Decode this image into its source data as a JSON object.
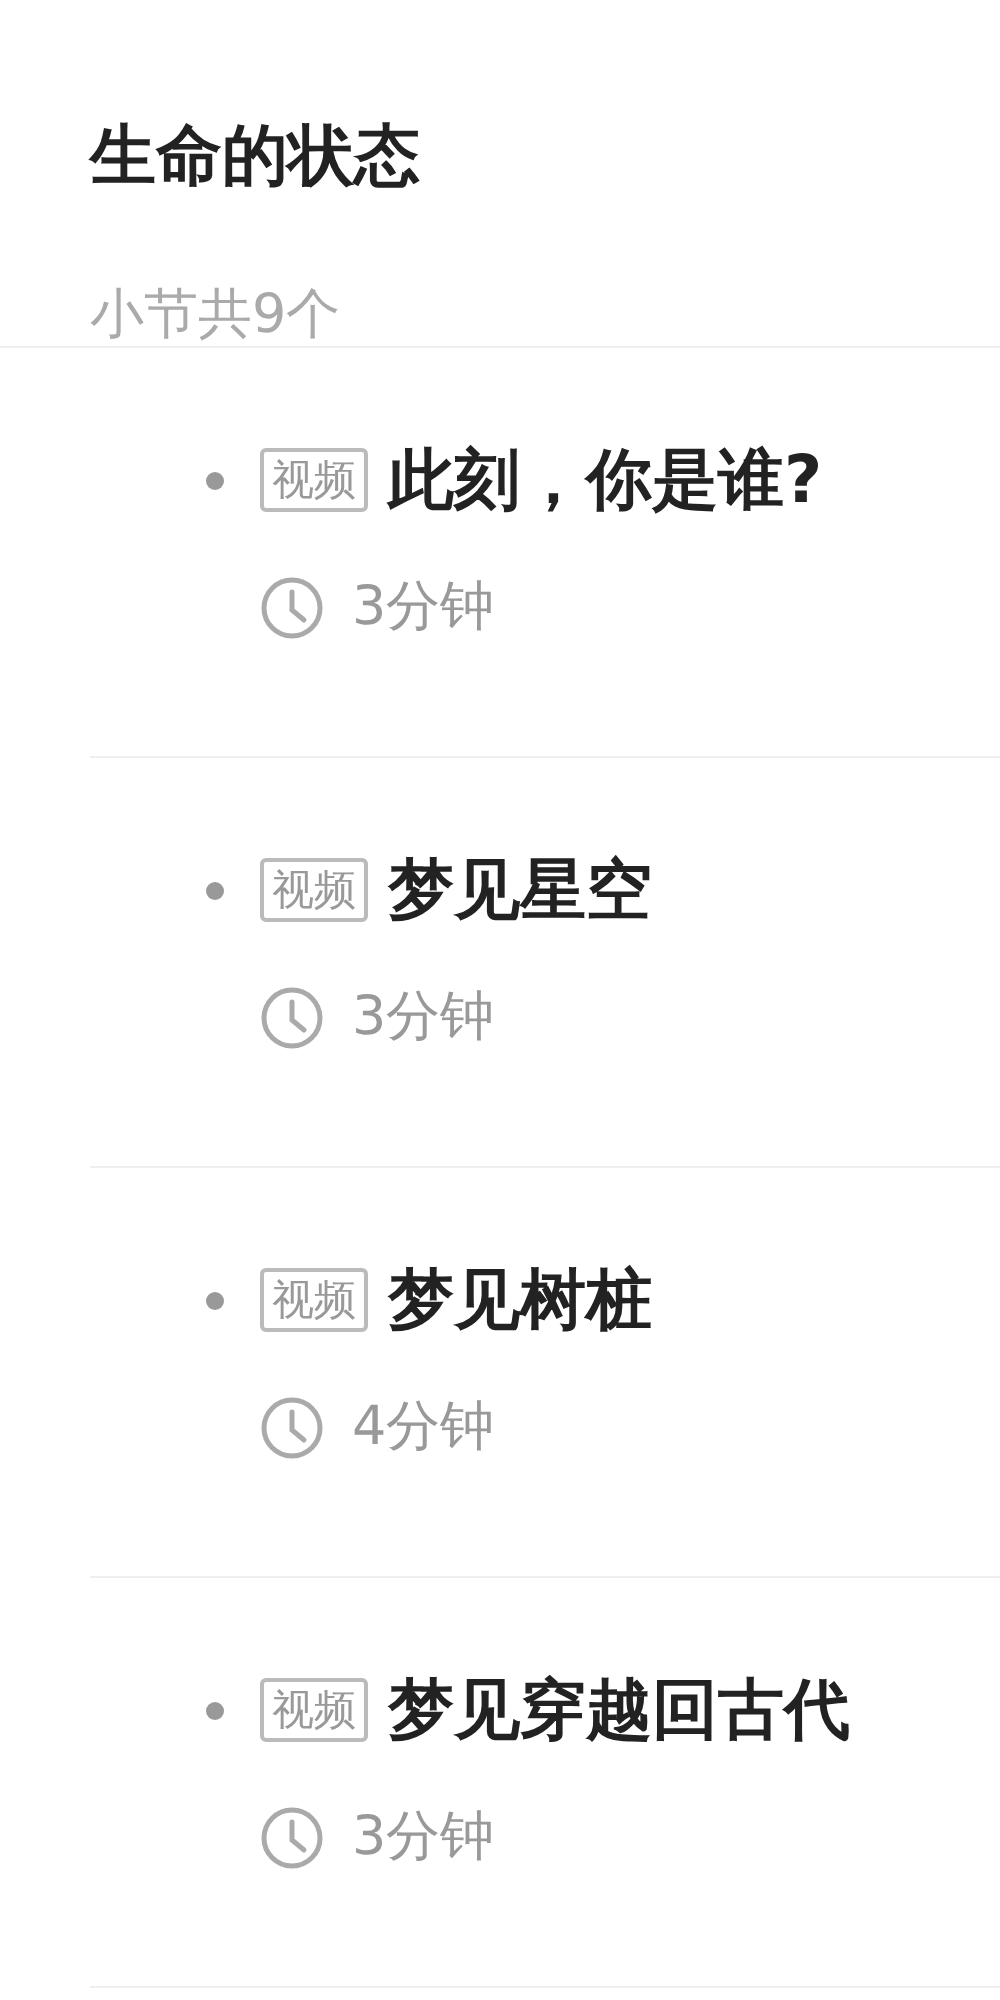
{
  "header": {
    "title": "生命的状态",
    "subtitle": "小节共9个"
  },
  "lessons": [
    {
      "tag": "视频",
      "title": "此刻，你是谁?",
      "duration": "3分钟"
    },
    {
      "tag": "视频",
      "title": "梦见星空",
      "duration": "3分钟"
    },
    {
      "tag": "视频",
      "title": "梦见树桩",
      "duration": "4分钟"
    },
    {
      "tag": "视频",
      "title": "梦见穿越回古代",
      "duration": "3分钟"
    }
  ]
}
